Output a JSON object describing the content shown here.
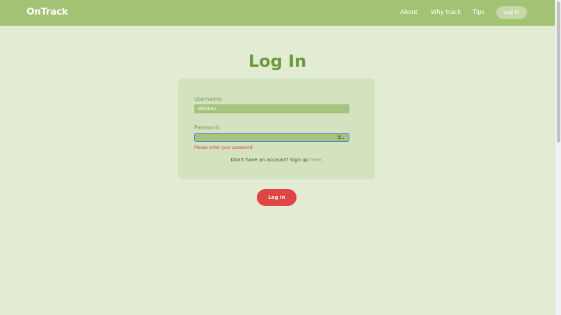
{
  "header": {
    "logo": "OnTrack",
    "nav": {
      "about": "About",
      "why_track": "Why track",
      "tips": "Tips",
      "login": "Log in"
    }
  },
  "main": {
    "title": "Log In",
    "form": {
      "username_label": "Username:",
      "username_value": "dietitian",
      "password_label": "Password:",
      "password_value": "",
      "password_icon": "key-icon",
      "error": "Please enter your password.",
      "signup_text": "Don't have an account? Sign up ",
      "signup_link": "here",
      "signup_suffix": "."
    },
    "submit_label": "Log In"
  },
  "colors": {
    "header_bg": "#a2c373",
    "page_bg": "#e2ecd3",
    "card_bg": "#d3e2bf",
    "title": "#6a9a3a",
    "error": "#d94040",
    "submit_bg": "#e14444"
  }
}
